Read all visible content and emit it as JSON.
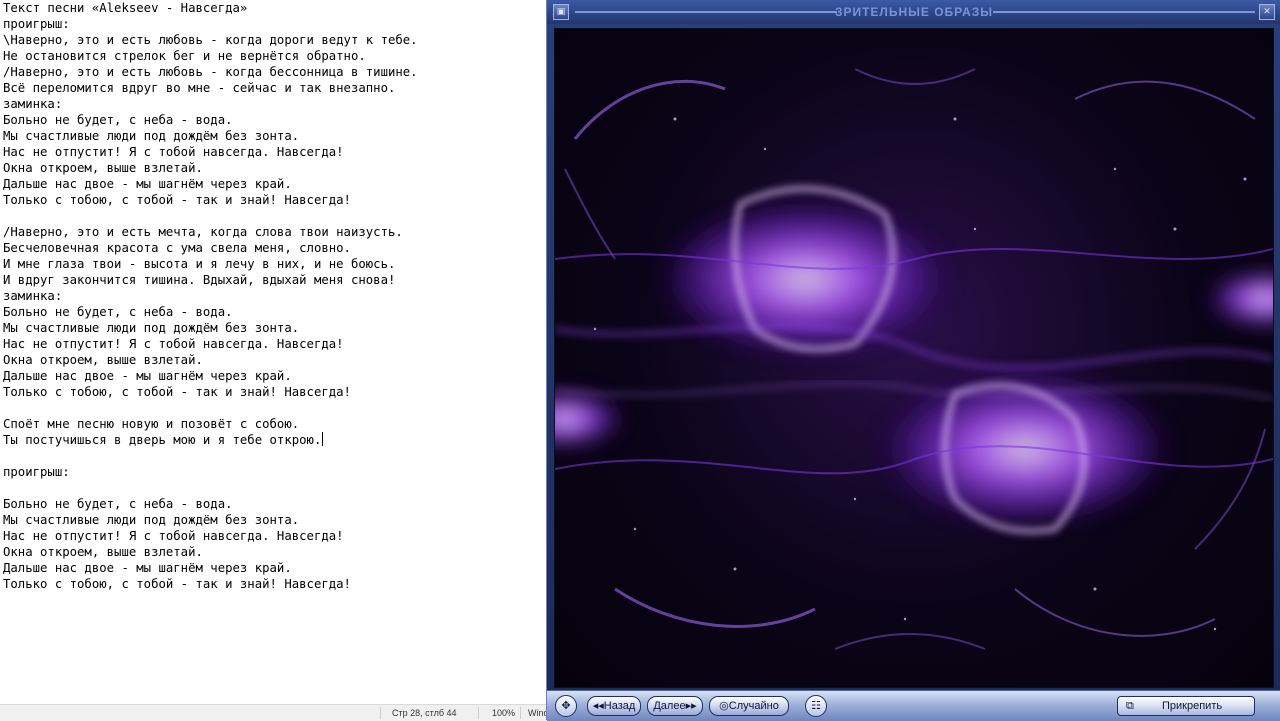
{
  "editor": {
    "lines": [
      "Текст песни «Alekseev - Навсегда»",
      "проигрыш:",
      "\\Наверно, это и есть любовь - когда дороги ведут к тебе.",
      "Не остановится стрелок бег и не вернётся обратно.",
      "/Наверно, это и есть любовь - когда бессонница в тишине.",
      "Всё переломится вдруг во мне - сейчас и так внезапно.",
      "заминка:",
      "Больно не будет, с неба - вода.",
      "Мы счастливые люди под дождём без зонта.",
      "Нас не отпустит! Я с тобой навсегда. Навсегда!",
      "Окна откроем, выше взлетай.",
      "Дальше нас двое - мы шагнём через край.",
      "Только с тобою, с тобой - так и знай! Навсегда!",
      "",
      "/Наверно, это и есть мечта, когда слова твои наизусть.",
      "Бесчеловечная красота с ума свела меня, словно.",
      "И мне глаза твои - высота и я лечу в них, и не боюсь.",
      "И вдруг закончится тишина. Вдыхай, вдыхай меня снова!",
      "заминка:",
      "Больно не будет, с неба - вода.",
      "Мы счастливые люди под дождём без зонта.",
      "Нас не отпустит! Я с тобой навсегда. Навсегда!",
      "Окна откроем, выше взлетай.",
      "Дальше нас двое - мы шагнём через край.",
      "Только с тобою, с тобой - так и знай! Навсегда!",
      "",
      "Споёт мне песню новую и позовёт с собою.",
      "Ты постучишься в дверь мою и я тебе открою.",
      "",
      "проигрыш:",
      "",
      "Больно не будет, с неба - вода.",
      "Мы счастливые люди под дождём без зонта.",
      "Нас не отпустит! Я с тобой навсегда. Навсегда!",
      "Окна откроем, выше взлетай.",
      "Дальше нас двое - мы шагнём через край.",
      "Только с тобою, с тобой - так и знай! Навсегда!"
    ],
    "caret_line": 27
  },
  "statusbar": {
    "position": "Стр 28, стлб 44",
    "zoom": "100%",
    "encoding_partial": "Wind"
  },
  "player": {
    "title": "ЗРИТЕЛЬНЫЕ ОБРАЗЫ",
    "controls": {
      "back_label": "Назад",
      "next_label": "Далее",
      "random_label": "Случайно",
      "attach_label": "Прикрепить"
    },
    "colors": {
      "accent_violet": "#b14dff",
      "glow": "#e8c8ff",
      "frame_blue": "#2b3f78"
    }
  }
}
